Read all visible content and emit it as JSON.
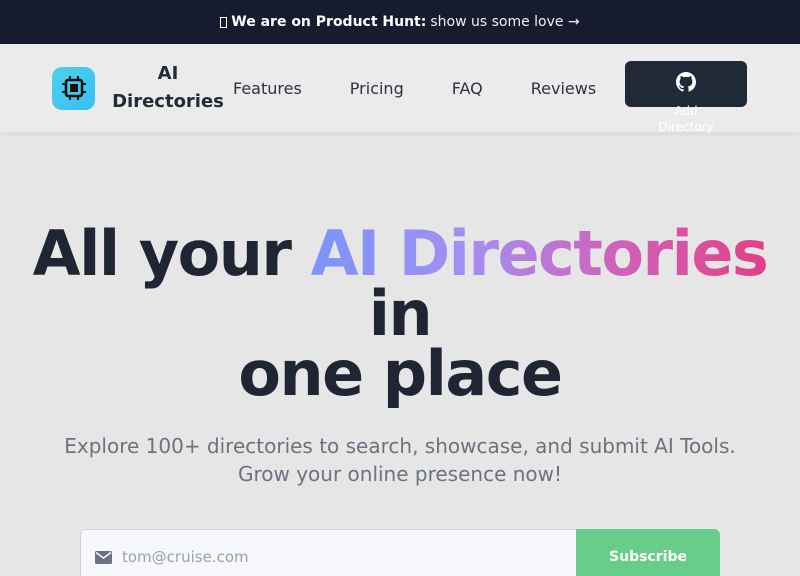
{
  "banner": {
    "bold_text": "We are on Product Hunt:",
    "love_text": "show us some love →"
  },
  "nav": {
    "brand_line1": "AI",
    "brand_line2": "Directories",
    "items": [
      "Features",
      "Pricing",
      "FAQ",
      "Reviews"
    ],
    "add_button_line1": "Add",
    "add_button_line2": "Directory"
  },
  "hero": {
    "headline_pre": "All your",
    "headline_grad": "AI Directories",
    "headline_post": "in",
    "headline_line2": "one place",
    "sub_line1": "Explore 100+ directories to search, showcase, and submit AI Tools.",
    "sub_line2": "Grow your online presence now!"
  },
  "form": {
    "placeholder": "tom@cruise.com",
    "subscribe_label": "Subscribe"
  },
  "colors": {
    "banner_bg": "#161b2e",
    "button_dark": "#1f2937",
    "subscribe_green": "#68cd88",
    "logo_cyan": "#4fd1e8"
  }
}
